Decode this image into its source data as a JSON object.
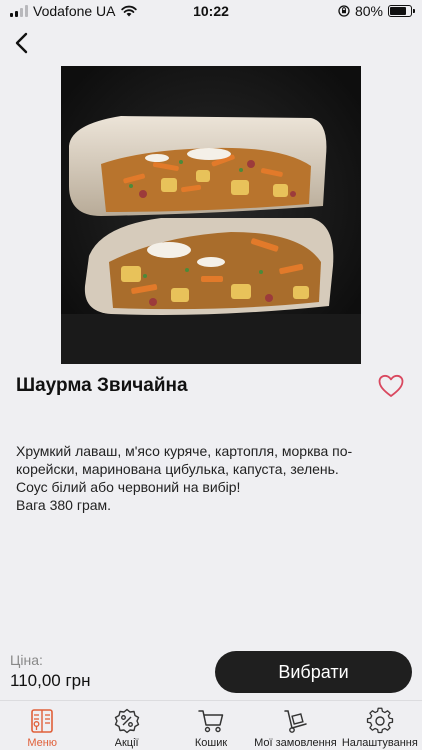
{
  "status_bar": {
    "carrier": "Vodafone UA",
    "time": "10:22",
    "battery_percent": "80%",
    "battery_level": 0.8
  },
  "product": {
    "title": "Шаурма Звичайна",
    "description": "Хрумкий лаваш, м'ясо куряче, картопля, морква по-корейски,  маринована цибулька, капуста, зелень.\nСоус білий або червоний на вибір!\nВага 380 грам.",
    "price_label": "Ціна:",
    "price": "110,00 грн",
    "select_label": "Вибрати"
  },
  "tabs": [
    {
      "label": "Меню",
      "icon": "menu-book-icon",
      "active": true
    },
    {
      "label": "Акції",
      "icon": "discount-badge-icon",
      "active": false
    },
    {
      "label": "Кошик",
      "icon": "cart-icon",
      "active": false
    },
    {
      "label": "Мої замовлення",
      "icon": "hand-truck-icon",
      "active": false
    },
    {
      "label": "Налаштування",
      "icon": "gear-icon",
      "active": false
    }
  ],
  "colors": {
    "accent": "#e0603a",
    "favorite": "#d9485f",
    "button_bg": "#1f1f1f",
    "background": "#efeff2"
  }
}
